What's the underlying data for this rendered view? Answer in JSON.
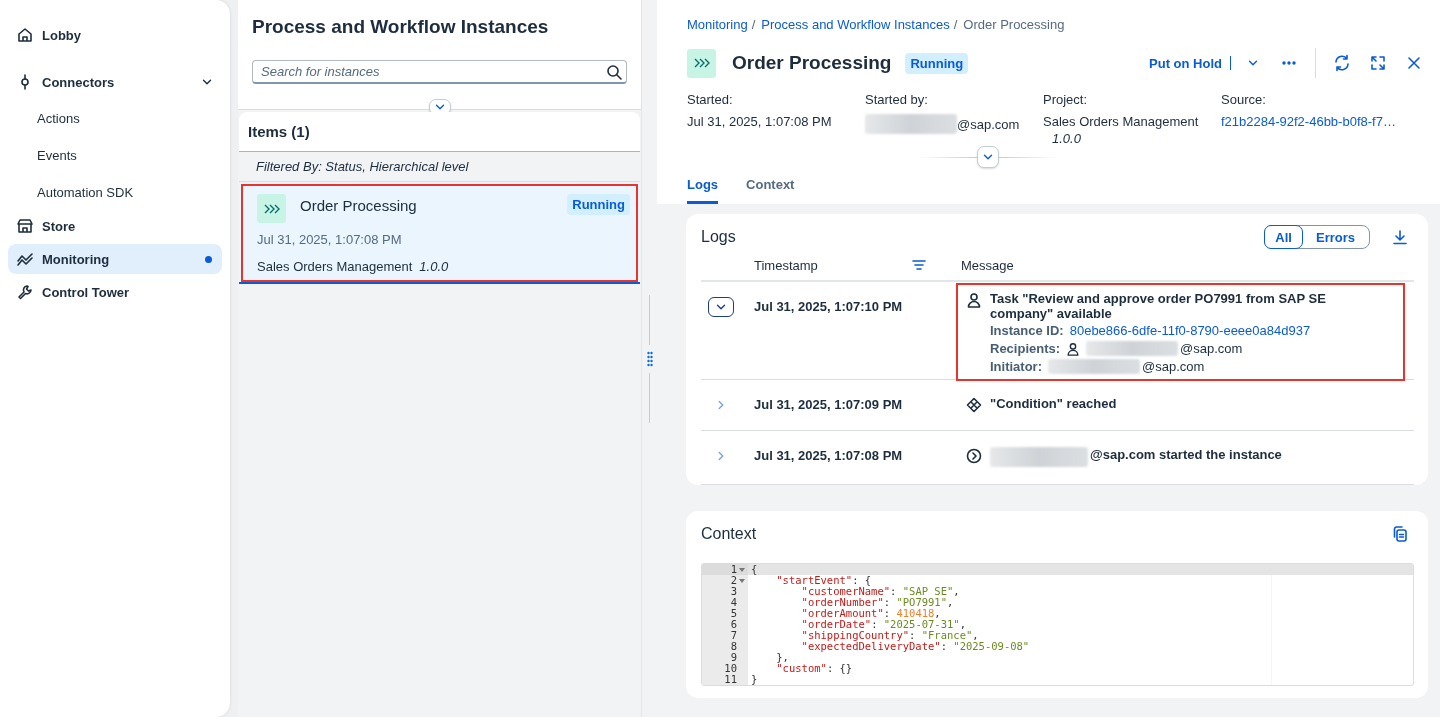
{
  "sidebar": {
    "items": [
      {
        "label": "Lobby",
        "selected": false,
        "indicator": false
      },
      {
        "label": "Connectors",
        "selected": false,
        "indicator": false,
        "expanded": true,
        "children": [
          {
            "label": "Actions",
            "selected": false
          },
          {
            "label": "Events",
            "selected": false
          },
          {
            "label": "Automation SDK",
            "selected": false
          }
        ]
      },
      {
        "label": "Store",
        "selected": false,
        "indicator": false
      },
      {
        "label": "Monitoring",
        "selected": true,
        "indicator": true
      },
      {
        "label": "Control Tower",
        "selected": false,
        "indicator": false
      }
    ]
  },
  "instances": {
    "title": "Process and Workflow Instances",
    "search": {
      "placeholder": "Search for instances"
    },
    "list_title": "Items (1)",
    "filter": "Filtered By: Status, Hierarchical level",
    "items": [
      {
        "title": "Order Processing",
        "status": "Running",
        "date": "Jul 31, 2025, 1:07:08 PM",
        "project": "Sales Orders Management",
        "version": "1.0.0",
        "selected": true,
        "highlighted": true
      }
    ]
  },
  "detail": {
    "breadcrumb": [
      {
        "label": "Monitoring",
        "link": true,
        "separator": "/"
      },
      {
        "label": "Process and Workflow Instances",
        "link": true,
        "separator": "/"
      },
      {
        "label": "Order Processing",
        "link": false
      }
    ],
    "title": "Order Processing",
    "status": "Running",
    "primary_action": "Put on Hold",
    "fields": [
      {
        "label": "Started:",
        "value": "Jul 31, 2025, 1:07:08 PM",
        "link": false,
        "redacted": false
      },
      {
        "label": "Started by:",
        "value": "@sap.com",
        "link": false,
        "redacted": true
      },
      {
        "label": "Project:",
        "value": "Sales Orders Management",
        "version": "1.0.0",
        "link": false,
        "redacted": false
      },
      {
        "label": "Source:",
        "value": "f21b2284-92f2-46bb-b0f8-f7…",
        "link": true,
        "redacted": false
      }
    ],
    "tabs": [
      {
        "label": "Logs",
        "selected": true
      },
      {
        "label": "Context",
        "selected": false
      }
    ],
    "logs": {
      "title": "Logs",
      "filters": [
        {
          "label": "All",
          "selected": true
        },
        {
          "label": "Errors",
          "selected": false
        }
      ],
      "columns": [
        "Timestamp",
        "Message"
      ],
      "rows": [
        {
          "kind": "task",
          "timestamp": "Jul 31, 2025, 1:07:10 PM",
          "expanded": true,
          "highlighted": true,
          "message": "Task \"Review and approve order PO7991 from SAP SE company\" available",
          "details": [
            {
              "label": "Instance ID:",
              "value": "80ebe866-6dfe-11f0-8790-eeee0a84d937",
              "link": true
            },
            {
              "label": "Recipients:",
              "value": "@sap.com",
              "link": false,
              "redacted": true,
              "person": true
            },
            {
              "label": "Initiator:",
              "value": "@sap.com",
              "link": false,
              "redacted": true
            }
          ]
        },
        {
          "kind": "condition",
          "timestamp": "Jul 31, 2025, 1:07:09 PM",
          "expanded": false,
          "message": "\"Condition\" reached"
        },
        {
          "kind": "start",
          "timestamp": "Jul 31, 2025, 1:07:08 PM",
          "expanded": false,
          "message": "@sap.com started the instance",
          "redacted": true
        }
      ]
    },
    "context": {
      "title": "Context",
      "lines": [
        {
          "number": "1",
          "text": "{",
          "foldable": true,
          "active": true
        },
        {
          "number": "2",
          "text": "    \"startEvent\": {",
          "foldable": true,
          "active": false
        },
        {
          "number": "3",
          "text": "        \"customerName\": \"SAP SE\",",
          "foldable": false,
          "active": false
        },
        {
          "number": "4",
          "text": "        \"orderNumber\": \"PO7991\",",
          "foldable": false,
          "active": false
        },
        {
          "number": "5",
          "text": "        \"orderAmount\": 410418,",
          "foldable": false,
          "active": false
        },
        {
          "number": "6",
          "text": "        \"orderDate\": \"2025-07-31\",",
          "foldable": false,
          "active": false
        },
        {
          "number": "7",
          "text": "        \"shippingCountry\": \"France\",",
          "foldable": false,
          "active": false
        },
        {
          "number": "8",
          "text": "        \"expectedDeliveryDate\": \"2025-09-08\"",
          "foldable": false,
          "active": false
        },
        {
          "number": "9",
          "text": "    },",
          "foldable": false,
          "active": false
        },
        {
          "number": "10",
          "text": "    \"custom\": {}",
          "foldable": false,
          "active": false
        },
        {
          "number": "11",
          "text": "}",
          "foldable": false,
          "active": false
        }
      ]
    }
  }
}
